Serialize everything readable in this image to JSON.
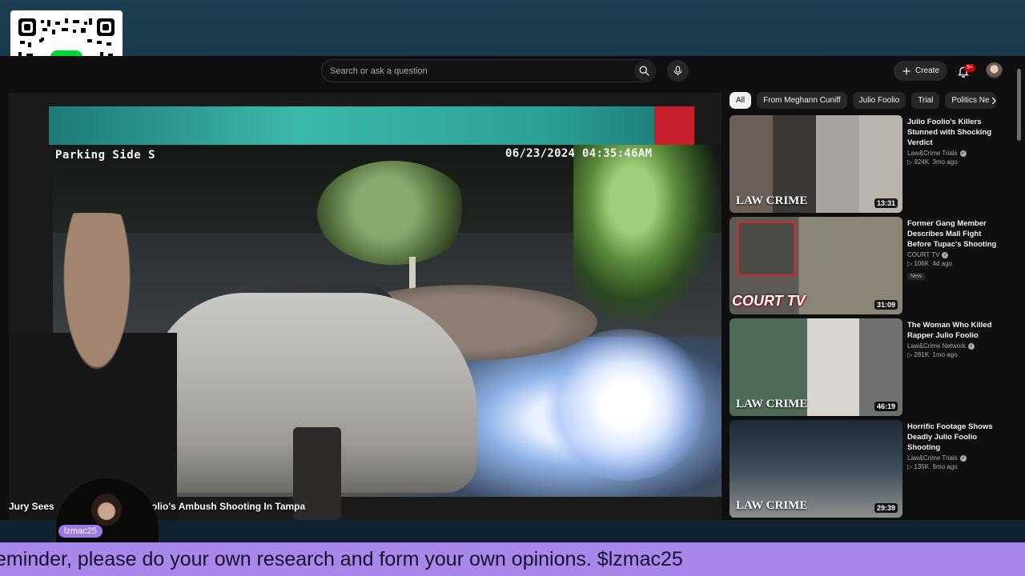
{
  "search": {
    "placeholder": "Search or ask a question"
  },
  "header": {
    "create_label": "Create",
    "notifications_badge": "9+"
  },
  "chips": [
    {
      "label": "All",
      "active": true
    },
    {
      "label": "From Meghann Cuniff"
    },
    {
      "label": "Julio Foolio"
    },
    {
      "label": "Trial"
    },
    {
      "label": "Politics Ne"
    }
  ],
  "player": {
    "cctv_label": "Parking Side S",
    "cctv_timestamp": "06/23/2024 04:35:46AM",
    "caption_left": "Jury Sees",
    "caption_right": "olio's Ambush Shooting In Tampa"
  },
  "streamer": {
    "tag": "lzmac25"
  },
  "recommendations": [
    {
      "title": "Julio Foolio's Killers Stunned with Shocking Verdict",
      "channel": "Law&Crime Trials",
      "views": "924K",
      "age": "3mo ago",
      "duration": "13:31",
      "brand": "LAW CRIME"
    },
    {
      "title": "Former Gang Member Describes Mall Fight Before Tupac's Shooting",
      "channel": "COURT TV",
      "views": "106K",
      "age": "4d ago",
      "duration": "31:09",
      "badge": "New",
      "brand": "COURT TV"
    },
    {
      "title": "The Woman Who Killed Rapper Julio Foolio",
      "channel": "Law&Crime Network",
      "views": "281K",
      "age": "1mo ago",
      "duration": "46:19",
      "brand": "LAW CRIME"
    },
    {
      "title": "Horrific Footage Shows Deadly Julio Foolio Shooting",
      "channel": "Law&Crime Trials",
      "views": "135K",
      "age": "9mo ago",
      "duration": "29:39",
      "brand": "LAW CRIME"
    }
  ],
  "ticker": {
    "text": "eminder, please do your own research and form your own opinions. $lzmac25"
  },
  "colors": {
    "ticker_bg": "#a788ea",
    "badge_red": "#cc0000",
    "cashapp_green": "#00d632"
  },
  "icons": [
    "search-icon",
    "mic-icon",
    "plus-icon",
    "bell-icon",
    "chevron-right-icon",
    "verified-icon",
    "cashapp-icon"
  ]
}
